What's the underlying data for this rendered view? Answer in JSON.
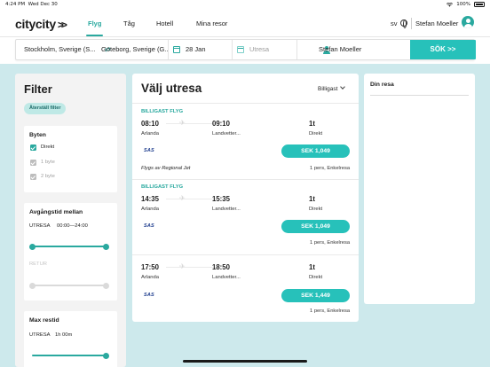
{
  "status": {
    "time": "4:24 PM",
    "date": "Wed Dec 30",
    "battery": "100%"
  },
  "header": {
    "logo": "citycity",
    "logo_chevrons": ">>",
    "tabs": [
      {
        "label": "Flyg",
        "active": true
      },
      {
        "label": "Tåg"
      },
      {
        "label": "Hotell"
      },
      {
        "label": "Mina resor"
      }
    ],
    "language": "sv",
    "user_name": "Stefan Moeller"
  },
  "search": {
    "from": "Stockholm, Sverige (S...",
    "to": "Göteborg, Sverige (G...",
    "depart_date": "28 Jan",
    "return_placeholder": "Utresa",
    "traveler": "Stefan Moeller",
    "search_label": "SÖK",
    "search_chevrons": ">>"
  },
  "filter": {
    "title": "Filter",
    "reset_label": "Återställ filter",
    "stops": {
      "title": "Byten",
      "options": [
        {
          "label": "Direkt",
          "checked": true,
          "enabled": true
        },
        {
          "label": "1 byte",
          "checked": true,
          "enabled": false
        },
        {
          "label": "2 byte",
          "checked": true,
          "enabled": false
        }
      ]
    },
    "departure_time": {
      "title": "Avgångstid mellan",
      "outbound_label": "UTRESA",
      "outbound_range": "00:00—24:00",
      "return_label": "RETUR"
    },
    "max_travel_time": {
      "title": "Max restid",
      "outbound_label": "UTRESA",
      "outbound_value": "1h 00m"
    }
  },
  "results": {
    "title": "Välj utresa",
    "sort_label": "Billigast",
    "flights": [
      {
        "tag": "BILLIGAST FLYG",
        "depart_time": "08:10",
        "depart_airport": "Arlanda",
        "arrive_time": "09:10",
        "arrive_airport": "Landvetter...",
        "duration": "1t",
        "stops": "Direkt",
        "airline_logo": "SAS",
        "price": "SEK 1,049",
        "operated_by": "Flygs av Regional Jet",
        "pax_info": "1 pers, Enkelresa"
      },
      {
        "tag": "BILLIGAST FLYG",
        "depart_time": "14:35",
        "depart_airport": "Arlanda",
        "arrive_time": "15:35",
        "arrive_airport": "Landvetter...",
        "duration": "1t",
        "stops": "Direkt",
        "airline_logo": "SAS",
        "price": "SEK 1,049",
        "pax_info": "1 pers, Enkelresa"
      },
      {
        "depart_time": "17:50",
        "depart_airport": "Arlanda",
        "arrive_time": "18:50",
        "arrive_airport": "Landvetter...",
        "duration": "1t",
        "stops": "Direkt",
        "airline_logo": "SAS",
        "price": "SEK 1,449",
        "pax_info": "1 pers, Enkelresa"
      }
    ]
  },
  "trip": {
    "title": "Din resa"
  },
  "colors": {
    "accent": "#2aa99f",
    "button": "#27c1ba",
    "background": "#cde9ec"
  }
}
